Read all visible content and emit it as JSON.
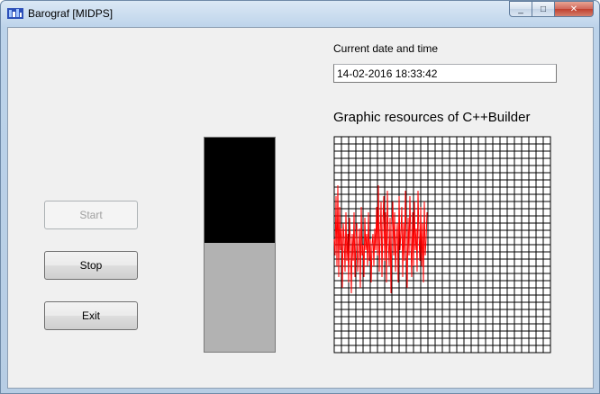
{
  "window": {
    "title": "Barograf [MIDPS]",
    "controls": {
      "minimize": "_",
      "maximize": "□",
      "close": "✕"
    }
  },
  "buttons": {
    "start_label": "Start",
    "start_enabled": false,
    "stop_label": "Stop",
    "exit_label": "Exit"
  },
  "gauge": {
    "level_fraction": 0.49,
    "fill_color": "#000000",
    "background_color": "#b2b2b2"
  },
  "datetime": {
    "label": "Current date and time",
    "value": "14-02-2016 18:33:42"
  },
  "graphics": {
    "heading": "Graphic resources of C++Builder"
  },
  "chart_data": {
    "type": "line",
    "grid": true,
    "grid_cells_x": 30,
    "grid_cells_y": 30,
    "line_color": "#ff0000",
    "xlim": [
      0,
      240
    ],
    "ylim": [
      -1,
      1
    ],
    "series": [
      {
        "values": [
          0.05,
          -0.1,
          0.45,
          -0.2,
          0.55,
          -0.3,
          0.35,
          -0.05,
          0.15,
          -0.4,
          0.2,
          0.05,
          -0.25,
          0.3,
          -0.15,
          0.1,
          -0.35,
          0.25,
          0.0,
          -0.45,
          0.1,
          -0.15,
          0.3,
          -0.3,
          0.05,
          0.2,
          -0.25,
          -0.05,
          0.15,
          -0.4,
          0.35,
          -0.1,
          0.0,
          -0.3,
          0.25,
          -0.05,
          0.1,
          -0.2,
          0.3,
          -0.15,
          0.05,
          -0.35,
          0.0,
          0.1,
          -0.2,
          0.15,
          -0.05,
          0.35,
          -0.1,
          0.55,
          -0.25,
          0.1,
          0.4,
          -0.3,
          0.2,
          0.45,
          -0.15,
          0.3,
          -0.35,
          0.5,
          0.05,
          -0.2,
          0.25,
          -0.45,
          0.15,
          0.4,
          -0.1,
          0.3,
          -0.25,
          0.05,
          0.2,
          -0.35,
          0.45,
          -0.05,
          0.1,
          0.35,
          -0.3,
          0.2,
          -0.15,
          0.5,
          0.0,
          -0.4,
          0.25,
          -0.1,
          0.45,
          0.05,
          -0.3,
          0.3,
          -0.2,
          0.4,
          -0.05,
          0.15,
          -0.25,
          0.5,
          0.1,
          -0.15,
          0.35,
          -0.2,
          0.2,
          -0.35,
          0.4,
          -0.1,
          0.05,
          0.3
        ]
      }
    ]
  }
}
